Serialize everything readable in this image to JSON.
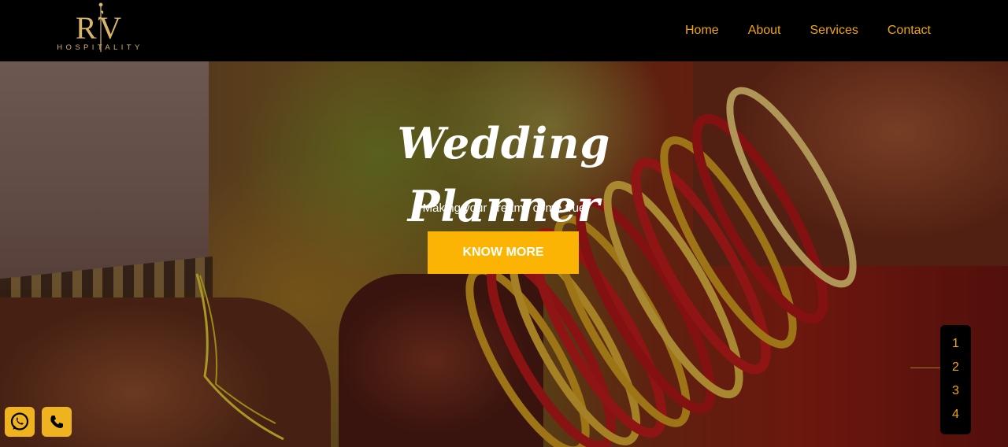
{
  "brand": {
    "logo_letters": "RV",
    "logo_subtitle": "HOSPITALITY",
    "accent_color": "#f0a800",
    "button_color": "#fbb304"
  },
  "nav": {
    "items": [
      {
        "label": "Home"
      },
      {
        "label": "About"
      },
      {
        "label": "Services"
      },
      {
        "label": "Contact"
      }
    ]
  },
  "hero": {
    "title": "Wedding Planner",
    "subtitle": "Making your dreams come true",
    "cta_label": "KNOW MORE"
  },
  "pager": {
    "items": [
      "1",
      "2",
      "3",
      "4"
    ],
    "active": "2"
  },
  "floating_buttons": {
    "whatsapp_icon": "whatsapp-icon",
    "phone_icon": "phone-icon"
  }
}
